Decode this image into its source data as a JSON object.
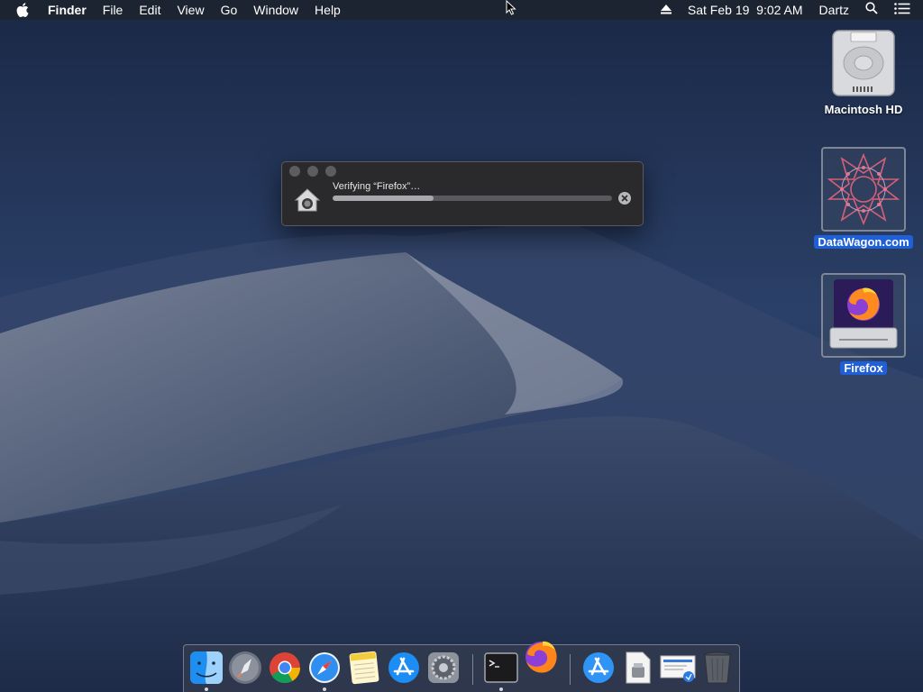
{
  "menubar": {
    "app_name": "Finder",
    "menus": [
      "File",
      "Edit",
      "View",
      "Go",
      "Window",
      "Help"
    ],
    "clock": "Sat Feb 19  9:02 AM",
    "user": "Dartz"
  },
  "desktop_icons": [
    {
      "label": "Macintosh HD",
      "icon": "hard-drive-icon",
      "selected": false
    },
    {
      "label": "DataWagon.com",
      "icon": "datawagon-image-icon",
      "selected": true
    },
    {
      "label": "Firefox",
      "icon": "firefox-disk-image-icon",
      "selected": true
    }
  ],
  "verify_dialog": {
    "title": "Verifying “Firefox”…",
    "progress_percent": 36
  },
  "dock": {
    "items": [
      {
        "name": "Finder",
        "icon": "finder-icon",
        "running": true
      },
      {
        "name": "Launchpad",
        "icon": "launchpad-icon",
        "running": false
      },
      {
        "name": "Google Chrome",
        "icon": "chrome-icon",
        "running": false
      },
      {
        "name": "Safari",
        "icon": "safari-icon",
        "running": true
      },
      {
        "name": "Notes",
        "icon": "notes-icon",
        "running": false
      },
      {
        "name": "App Store",
        "icon": "app-store-icon",
        "running": false
      },
      {
        "name": "System Preferences",
        "icon": "system-preferences-icon",
        "running": false
      },
      {
        "name": "Terminal",
        "icon": "terminal-icon",
        "running": true
      },
      {
        "name": "Firefox",
        "icon": "firefox-icon",
        "running": false
      },
      {
        "name": "Applications",
        "icon": "applications-folder-icon",
        "running": false
      },
      {
        "name": "Documents",
        "icon": "documents-stack-icon",
        "running": false
      },
      {
        "name": "Downloads",
        "icon": "downloads-stack-icon",
        "running": false
      },
      {
        "name": "Trash",
        "icon": "trash-icon",
        "running": false
      }
    ]
  },
  "colors": {
    "selection_blue": "#1f5fd8",
    "window_bg": "#2a2a2c",
    "menubar_text": "#ffffff"
  }
}
